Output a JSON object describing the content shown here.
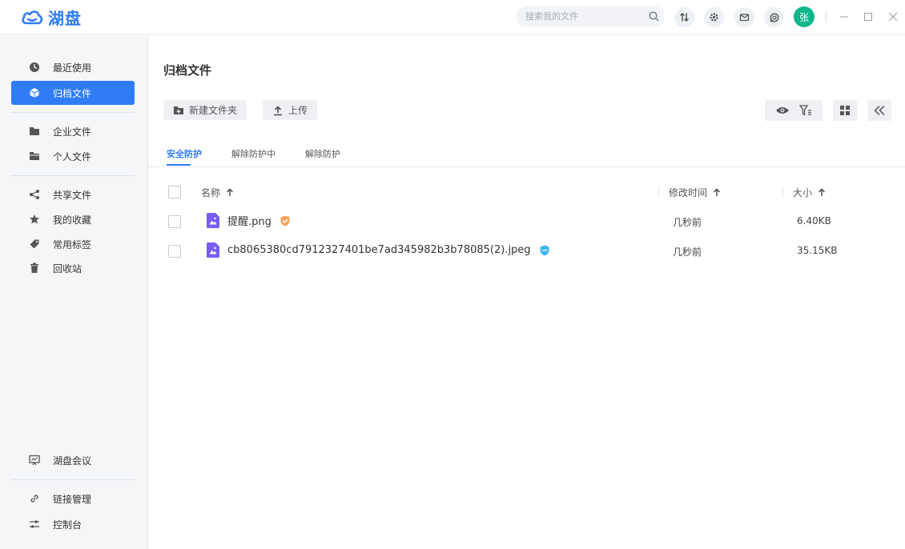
{
  "app": {
    "logo_text": "湖盘"
  },
  "search": {
    "placeholder": "搜索我的文件"
  },
  "user": {
    "avatar_char": "张"
  },
  "colors": {
    "primary": "#2f7cf6",
    "avatar": "#10b68a",
    "badge_orange": "#f5a35b",
    "badge_blue": "#3fb5f2",
    "file_purple": "#7a5df5"
  },
  "sidebar": {
    "items": [
      {
        "label": "最近使用",
        "icon": "clock-icon"
      },
      {
        "label": "归档文件",
        "icon": "cube-icon",
        "active": true
      },
      {
        "label": "企业文件",
        "icon": "folder-icon"
      },
      {
        "label": "个人文件",
        "icon": "folder-open-icon"
      },
      {
        "label": "共享文件",
        "icon": "share-icon"
      },
      {
        "label": "我的收藏",
        "icon": "star-icon"
      },
      {
        "label": "常用标签",
        "icon": "tag-icon"
      },
      {
        "label": "回收站",
        "icon": "trash-icon"
      }
    ],
    "bottom_items": [
      {
        "label": "湖盘会议",
        "icon": "meeting-icon"
      },
      {
        "label": "链接管理",
        "icon": "link-icon"
      },
      {
        "label": "控制台",
        "icon": "console-icon"
      }
    ]
  },
  "main": {
    "title": "归档文件",
    "toolbar": {
      "new_folder": "新建文件夹",
      "upload": "上传"
    },
    "tabs": [
      {
        "label": "安全防护",
        "active": true
      },
      {
        "label": "解除防护中"
      },
      {
        "label": "解除防护"
      }
    ],
    "table": {
      "headers": {
        "name": "名称",
        "modified": "修改时间",
        "size": "大小"
      },
      "rows": [
        {
          "name": "提醒.png",
          "modified": "几秒前",
          "size": "6.40KB",
          "badge": "orange-shield-icon"
        },
        {
          "name": "cb8065380cd7912327401be7ad345982b3b78085(2).jpeg",
          "modified": "几秒前",
          "size": "35.15KB",
          "badge": "blue-shield-icon"
        }
      ]
    }
  }
}
